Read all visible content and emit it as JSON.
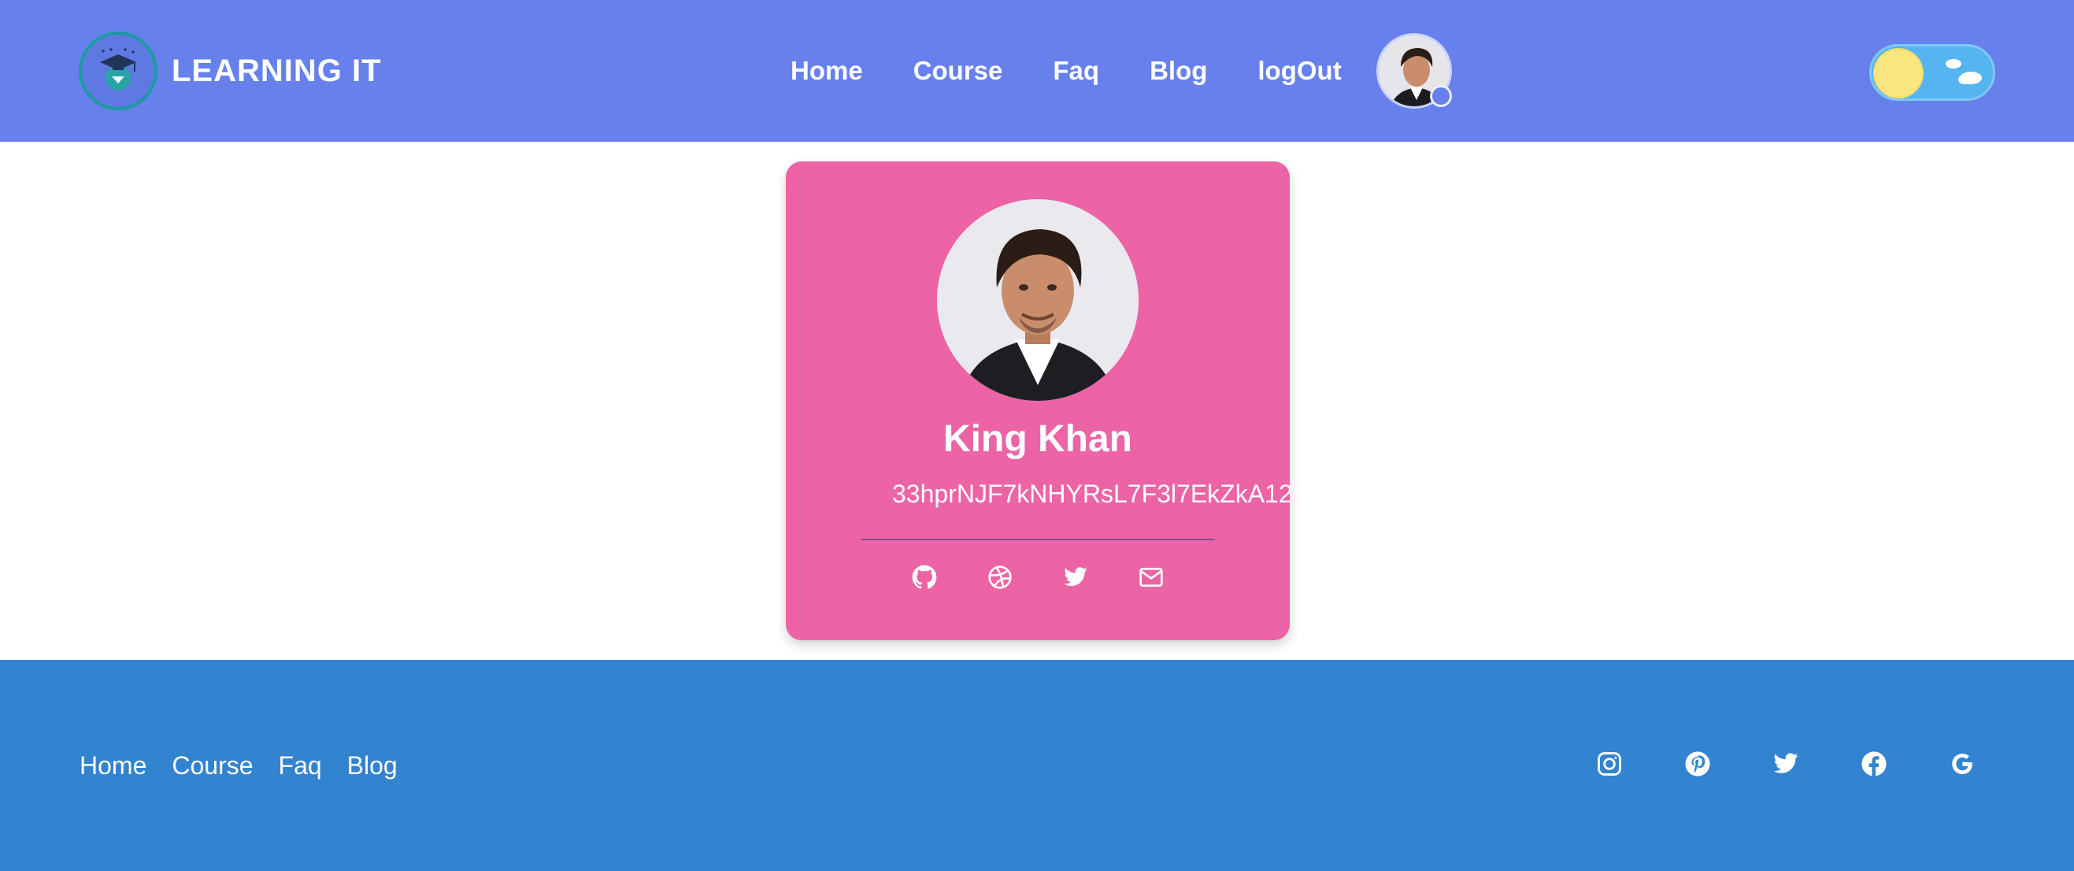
{
  "brand": {
    "name": "LEARNING IT",
    "logo_icon": "graduation-cap-icon"
  },
  "nav": {
    "links": [
      {
        "label": "Home"
      },
      {
        "label": "Course"
      },
      {
        "label": "Faq"
      },
      {
        "label": "Blog"
      },
      {
        "label": "logOut"
      }
    ],
    "avatar_icon": "user-avatar",
    "theme_toggle": {
      "state": "light",
      "icons": [
        "sun-icon",
        "cloud-icon"
      ]
    }
  },
  "profile": {
    "name": "King Khan",
    "id": "33hprNJF7kNHYRsL7F3l7EkZkA12",
    "social_icons": [
      "github-icon",
      "dribbble-icon",
      "twitter-icon",
      "mail-icon"
    ]
  },
  "footer": {
    "links": [
      {
        "label": "Home"
      },
      {
        "label": "Course"
      },
      {
        "label": "Faq"
      },
      {
        "label": "Blog"
      }
    ],
    "social_icons": [
      "instagram-icon",
      "pinterest-icon",
      "twitter-icon",
      "facebook-icon",
      "google-icon"
    ]
  },
  "colors": {
    "navbar": "#6780ec",
    "card": "#ec64a5",
    "footer": "#3283d0",
    "toggle_track": "#54b5f0",
    "toggle_knob": "#fbe57f"
  }
}
